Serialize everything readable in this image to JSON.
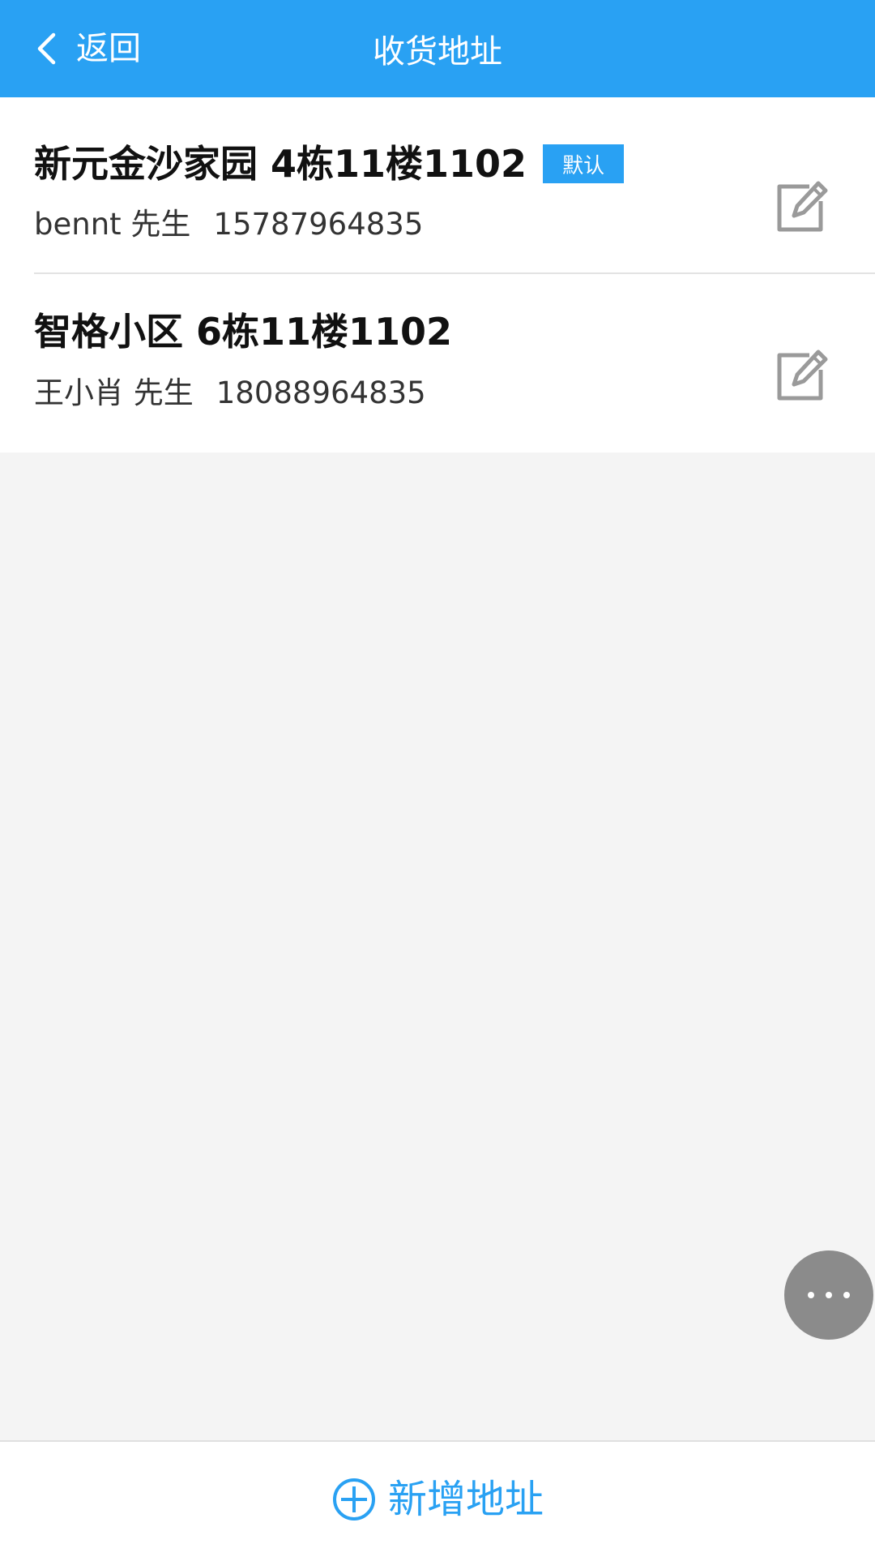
{
  "header": {
    "back_label": "返回",
    "title": "收货地址"
  },
  "addresses": [
    {
      "address": "新元金沙家园 4栋11楼1102",
      "badge": "默认",
      "name": "bennt 先生",
      "phone": "15787964835",
      "is_default": true
    },
    {
      "address": "智格小区 6栋11楼1102",
      "name": "王小肖 先生",
      "phone": "18088964835",
      "is_default": false
    }
  ],
  "footer": {
    "add_label": "新增地址"
  },
  "icons": {
    "back": "chevron-left-icon",
    "edit": "edit-icon",
    "more": "more-dots-icon",
    "add": "plus-circle-icon"
  },
  "colors": {
    "accent": "#29a1f3",
    "page_background": "#f4f4f4",
    "fab": "#8b8b8b"
  }
}
